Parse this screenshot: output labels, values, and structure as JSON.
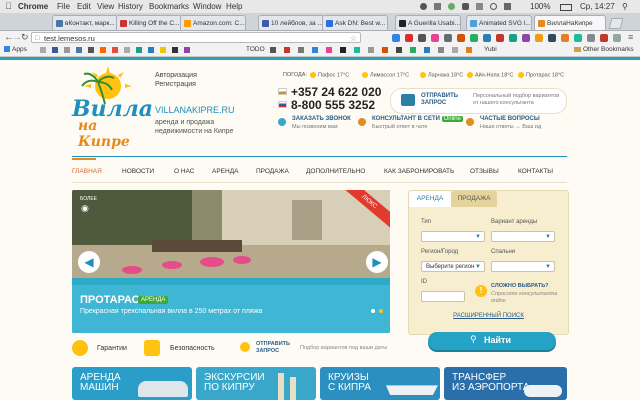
{
  "menubar": {
    "items": [
      "Chrome",
      "File",
      "Edit",
      "View",
      "History",
      "Bookmarks",
      "Window",
      "Help"
    ],
    "battery": "100%",
    "clock": "Ср, 14:27"
  },
  "tabs": [
    {
      "label": "вКонтакт, марк...",
      "color": "#4a76a8"
    },
    {
      "label": "Killing Off the C...",
      "color": "#c33"
    },
    {
      "label": "Amazon.com: C...",
      "color": "#f90"
    },
    {
      "label": "10 лейблов, за ...",
      "color": "#3c5ba8"
    },
    {
      "label": "Ask DN: Best w...",
      "color": "#2a6fdb"
    },
    {
      "label": "A Guerilla Usabi...",
      "color": "#222"
    },
    {
      "label": "Animated SVG l...",
      "color": "#4aa3d6"
    },
    {
      "label": "ВиллаНаКипре",
      "color": "#e48b1f"
    }
  ],
  "address": {
    "url": "test.lemesos.ru"
  },
  "bookmarks": {
    "apps": "Apps",
    "todo": "TODO",
    "yubi": "Yubi",
    "other": "Other Bookmarks"
  },
  "site": {
    "auth_links": [
      "Авторизация",
      "Регистрация"
    ],
    "logo_line1": "Вилла",
    "logo_line2": "на Кипре",
    "domain": "VILLANAKIPRE.RU",
    "tagline": "аренда и продажа недвижимости на Кипре",
    "weather_label": "ПОГОДА:",
    "weather": [
      "Пафос 17°C",
      "Лимассол 17°C",
      "Ларнака 18°C",
      "Айя-Напа 18°C",
      "Протарас 18°C"
    ],
    "phone1": "+357 24 622 020",
    "phone2": "8-800 555 3252",
    "send_request": {
      "title": "ОТПРАВИТЬ ЗАПРОС",
      "desc": "Персональный подбор вариантов от нашего консультанта"
    },
    "order_call": {
      "title": "ЗАКАЗАТЬ ЗВОНОК",
      "desc": "Мы позвоним вам"
    },
    "online": {
      "title": "КОНСУЛЬТАНТ В СЕТИ",
      "badge": "Online",
      "desc": "Быстрый ответ в чате"
    },
    "faq": {
      "title": "ЧАСТЫЕ ВОПРОСЫ",
      "desc": "Наши ответы → Ваш ид"
    },
    "nav": [
      "ГЛАВНАЯ",
      "НОВОСТИ",
      "О НАС",
      "АРЕНДА",
      "ПРОДАЖА",
      "ДОПОЛНИТЕЛЬНО",
      "КАК ЗАБРОНИРОВАТЬ",
      "ОТЗЫВЫ",
      "КОНТАКТЫ"
    ],
    "slider": {
      "more": "БОЛЕЕ",
      "ribbon": "ЛЮКС",
      "place": "ПРОТАРАС",
      "badge": "АРЕНДА",
      "caption": "Прекрасная трехспальная вилла в 250 метрах от пляжа"
    },
    "search": {
      "tab_rent": "АРЕНДА",
      "tab_sale": "ПРОДАЖА",
      "type_label": "Тип",
      "variant_label": "Вариант аренды",
      "region_label": "Регион/Город",
      "bedrooms_label": "Спальни",
      "region_value": "Выберите регион",
      "id_label": "ID",
      "hard_title": "СЛОЖНО ВЫБРАТЬ?",
      "hard_desc": "Спросите консультанта online",
      "advanced": "РАСШИРЕННЫЙ ПОИСК",
      "find": "Найти"
    },
    "features": {
      "guarantee": "Гарантии",
      "security": "Безопасность",
      "request": "ОТПРАВИТЬ ЗАПРОС",
      "request_desc": "Подбор вариантов под ваши даты"
    },
    "promos": [
      {
        "text": "АРЕНДА\nМАШИН",
        "color": "#2a9dc9"
      },
      {
        "text": "ЭКСКУРСИИ\nПО КИПРУ",
        "color": "#38a7c9"
      },
      {
        "text": "КРУИЗЫ\nС КИПРА",
        "color": "#2b8fbf"
      },
      {
        "text": "ТРАНСФЕР\nИЗ АЭРОПОРТА",
        "color": "#2b6faa"
      }
    ]
  }
}
